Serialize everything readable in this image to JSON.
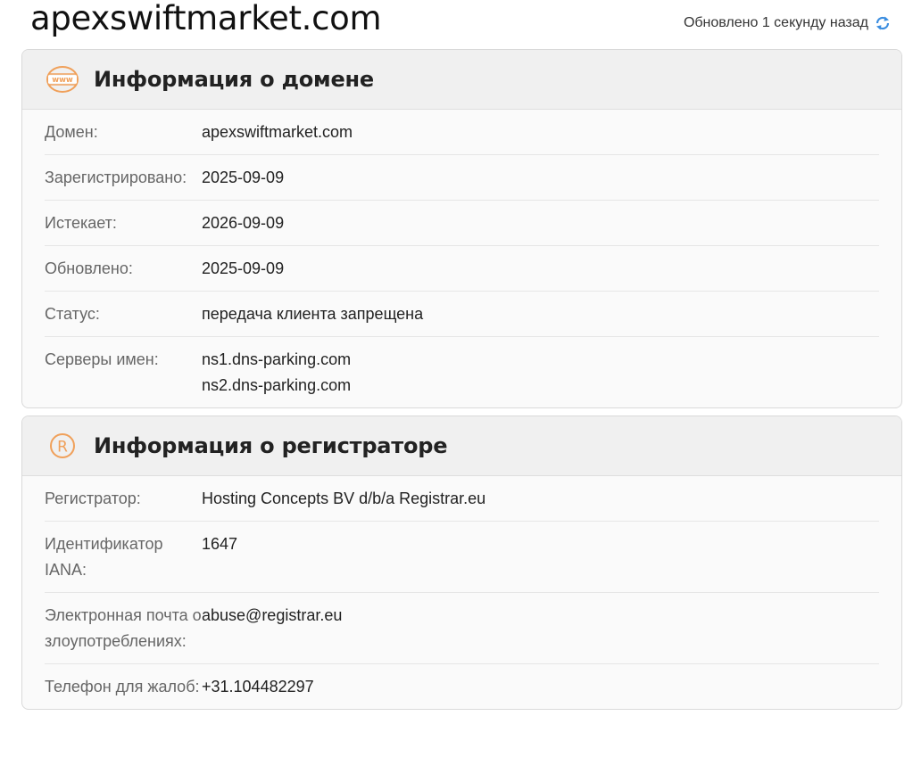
{
  "header": {
    "site_title": "apexswiftmarket.com",
    "updated_text": "Обновлено 1 секунду назад"
  },
  "colors": {
    "accent_orange": "#f0a05a",
    "refresh_blue": "#3a8de0"
  },
  "icons": {
    "domain": "www-globe-icon",
    "registrar": "registered-icon",
    "refresh": "refresh-icon"
  },
  "domain_card": {
    "title": "Информация о домене",
    "rows": [
      {
        "label": "Домен:",
        "value": "apexswiftmarket.com"
      },
      {
        "label": "Зарегистрировано:",
        "value": "2025-09-09"
      },
      {
        "label": "Истекает:",
        "value": "2026-09-09"
      },
      {
        "label": "Обновлено:",
        "value": "2025-09-09"
      },
      {
        "label": "Статус:",
        "value": "передача клиента запрещена"
      },
      {
        "label": "Серверы имен:",
        "values": [
          "ns1.dns-parking.com",
          "ns2.dns-parking.com"
        ]
      }
    ]
  },
  "registrar_card": {
    "title": "Информация о регистраторе",
    "rows": [
      {
        "label": "Регистратор:",
        "value": "Hosting Concepts BV d/b/a Registrar.eu"
      },
      {
        "label": "Идентификатор IANA:",
        "value": "1647"
      },
      {
        "label": "Электронная почта о злоупотреблениях:",
        "value": "abuse@registrar.eu"
      },
      {
        "label": "Телефон для жалоб:",
        "value": "+31.104482297"
      }
    ]
  }
}
